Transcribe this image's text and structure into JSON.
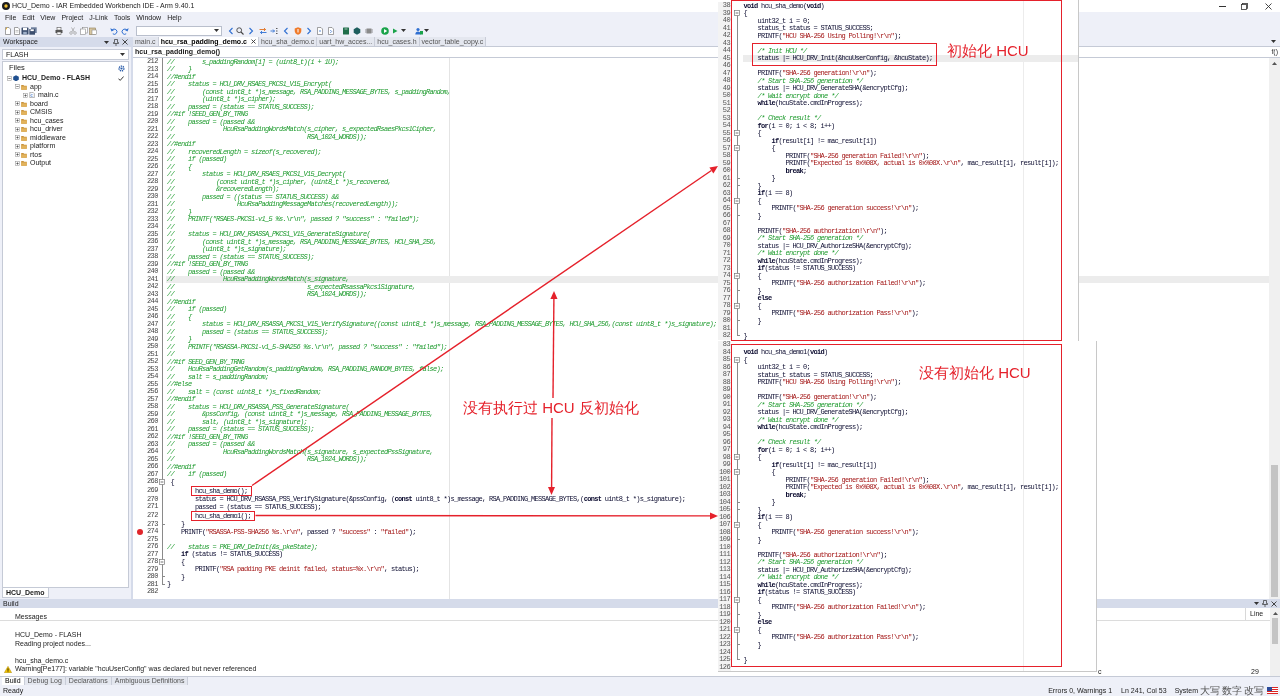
{
  "window": {
    "title": "HCU_Demo - IAR Embedded Workbench IDE - Arm 9.40.1"
  },
  "menu": [
    "File",
    "Edit",
    "View",
    "Project",
    "J-Link",
    "Tools",
    "Window",
    "Help"
  ],
  "workspace": {
    "title": "Workspace",
    "configuration": "FLASH",
    "files_header": "Files",
    "project": {
      "name": "HCU_Demo - FLASH",
      "kind": "project",
      "active": true,
      "expanded": true,
      "children": [
        {
          "name": "app",
          "kind": "folder",
          "expanded": true,
          "children": [
            {
              "name": "main.c",
              "kind": "file",
              "expanded": false
            }
          ]
        },
        {
          "name": "board",
          "kind": "folder",
          "expanded": false
        },
        {
          "name": "CMSIS",
          "kind": "folder",
          "expanded": false
        },
        {
          "name": "hcu_cases",
          "kind": "folder",
          "expanded": false
        },
        {
          "name": "hcu_driver",
          "kind": "folder",
          "expanded": false
        },
        {
          "name": "middleware",
          "kind": "folder",
          "expanded": false
        },
        {
          "name": "platform",
          "kind": "folder",
          "expanded": false
        },
        {
          "name": "rtos",
          "kind": "folder",
          "expanded": false
        },
        {
          "name": "Output",
          "kind": "folder",
          "expanded": false
        }
      ]
    },
    "tabs": [
      {
        "label": "HCU_Demo",
        "selected": true
      }
    ]
  },
  "editor": {
    "tabs": [
      {
        "label": "main.c",
        "selected": false
      },
      {
        "label": "hcu_rsa_padding_demo.c",
        "selected": true
      },
      {
        "label": "hcu_sha_demo.c",
        "selected": false
      },
      {
        "label": "uart_hw_acces...",
        "selected": false
      },
      {
        "label": "hcu_cases.h",
        "selected": false
      },
      {
        "label": "vector_table_copy.c",
        "selected": false
      }
    ],
    "function": "hcu_rsa_padding_demo()",
    "function_list_button": "f()",
    "lines": [
      {
        "number": "212",
        "tokens": [
          {
            "kind": "comment",
            "text": "//        s_paddingRandom[i] = (uint8_t)(i + 1U);"
          }
        ]
      },
      {
        "number": "213",
        "tokens": [
          {
            "kind": "comment",
            "text": "//    }"
          }
        ]
      },
      {
        "number": "214",
        "tokens": [
          {
            "kind": "comment",
            "text": "//#endif"
          }
        ]
      },
      {
        "number": "215",
        "tokens": [
          {
            "kind": "comment",
            "text": "//    status = HCU_DRV_RSAES_PKCS1_V15_Encrypt("
          }
        ]
      },
      {
        "number": "216",
        "tokens": [
          {
            "kind": "comment",
            "text": "//        (const uint8_t *)s_message, RSA_PADDING_MESSAGE_BYTES, s_paddingRandom,"
          }
        ]
      },
      {
        "number": "217",
        "tokens": [
          {
            "kind": "comment",
            "text": "//        (uint8_t *)s_cipher);"
          }
        ]
      },
      {
        "number": "218",
        "tokens": [
          {
            "kind": "comment",
            "text": "//    passed = (status == STATUS_SUCCESS);"
          }
        ]
      },
      {
        "number": "219",
        "tokens": [
          {
            "kind": "comment",
            "text": "//#if !SEED_GEN_BY_TRNG"
          }
        ]
      },
      {
        "number": "220",
        "tokens": [
          {
            "kind": "comment",
            "text": "//    passed = (passed &&"
          }
        ]
      },
      {
        "number": "221",
        "tokens": [
          {
            "kind": "comment",
            "text": "//              HcuRsaPaddingWordsMatch(s_cipher, s_expectedRsaesPkcs1Cipher,"
          }
        ]
      },
      {
        "number": "222",
        "tokens": [
          {
            "kind": "comment",
            "text": "//                                      RSA_1024_WORDS));"
          }
        ]
      },
      {
        "number": "223",
        "tokens": [
          {
            "kind": "comment",
            "text": "//#endif"
          }
        ]
      },
      {
        "number": "224",
        "tokens": [
          {
            "kind": "comment",
            "text": "//    recoveredLength = sizeof(s_recovered);"
          }
        ]
      },
      {
        "number": "225",
        "tokens": [
          {
            "kind": "comment",
            "text": "//    if (passed)"
          }
        ]
      },
      {
        "number": "226",
        "tokens": [
          {
            "kind": "comment",
            "text": "//    {"
          }
        ]
      },
      {
        "number": "227",
        "tokens": [
          {
            "kind": "comment",
            "text": "//        status = HCU_DRV_RSAES_PKCS1_V15_Decrypt("
          }
        ]
      },
      {
        "number": "228",
        "tokens": [
          {
            "kind": "comment",
            "text": "//            (const uint8_t *)s_cipher, (uint8_t *)s_recovered,"
          }
        ]
      },
      {
        "number": "229",
        "tokens": [
          {
            "kind": "comment",
            "text": "//            &recoveredLength);"
          }
        ]
      },
      {
        "number": "230",
        "tokens": [
          {
            "kind": "comment",
            "text": "//        passed = ((status == STATUS_SUCCESS) &&"
          }
        ]
      },
      {
        "number": "231",
        "tokens": [
          {
            "kind": "comment",
            "text": "//                  HcuRsaPaddingMessageMatches(recoveredLength));"
          }
        ]
      },
      {
        "number": "232",
        "tokens": [
          {
            "kind": "comment",
            "text": "//    }"
          }
        ]
      },
      {
        "number": "233",
        "tokens": [
          {
            "kind": "comment",
            "text": "//    PRINTF(\"RSAES-PKCS1-v1_5 %s.\\r\\n\", passed ? \"success\" : \"failed\");"
          }
        ]
      },
      {
        "number": "234",
        "tokens": [
          {
            "kind": "comment",
            "text": "//"
          }
        ]
      },
      {
        "number": "235",
        "tokens": [
          {
            "kind": "comment",
            "text": "//    status = HCU_DRV_RSASSA_PKCS1_V15_GenerateSignature("
          }
        ]
      },
      {
        "number": "236",
        "tokens": [
          {
            "kind": "comment",
            "text": "//        (const uint8_t *)s_message, RSA_PADDING_MESSAGE_BYTES, HCU_SHA_256,"
          }
        ]
      },
      {
        "number": "237",
        "tokens": [
          {
            "kind": "comment",
            "text": "//        (uint8_t *)s_signature);"
          }
        ]
      },
      {
        "number": "238",
        "tokens": [
          {
            "kind": "comment",
            "text": "//    passed = (status == STATUS_SUCCESS);"
          }
        ]
      },
      {
        "number": "239",
        "tokens": [
          {
            "kind": "comment",
            "text": "//#if !SEED_GEN_BY_TRNG"
          }
        ]
      },
      {
        "number": "240",
        "tokens": [
          {
            "kind": "comment",
            "text": "//    passed = (passed &&"
          }
        ]
      },
      {
        "number": "241",
        "current": true,
        "tokens": [
          {
            "kind": "comment",
            "text": "//              HcuRsaPaddingWordsMatch(s_signature,"
          }
        ]
      },
      {
        "number": "242",
        "tokens": [
          {
            "kind": "comment",
            "text": "//                                      s_expectedRsassaPkcs1Signature,"
          }
        ]
      },
      {
        "number": "243",
        "tokens": [
          {
            "kind": "comment",
            "text": "//                                      RSA_1024_WORDS));"
          }
        ]
      },
      {
        "number": "244",
        "tokens": [
          {
            "kind": "comment",
            "text": "//#endif"
          }
        ]
      },
      {
        "number": "245",
        "tokens": [
          {
            "kind": "comment",
            "text": "//    if (passed)"
          }
        ]
      },
      {
        "number": "246",
        "tokens": [
          {
            "kind": "comment",
            "text": "//    {"
          }
        ]
      },
      {
        "number": "247",
        "tokens": [
          {
            "kind": "comment",
            "text": "//        status = HCU_DRV_RSASSA_PKCS1_V15_VerifySignature((const uint8_t *)s_message, RSA_PADDING_MESSAGE_BYTES, HCU_SHA_256,(const uint8_t *)s_signature);"
          }
        ]
      },
      {
        "number": "248",
        "tokens": [
          {
            "kind": "comment",
            "text": "//        passed = (status == STATUS_SUCCESS);"
          }
        ]
      },
      {
        "number": "249",
        "tokens": [
          {
            "kind": "comment",
            "text": "//    }"
          }
        ]
      },
      {
        "number": "250",
        "tokens": [
          {
            "kind": "comment",
            "text": "//    PRINTF(\"RSASSA-PKCS1-v1_5-SHA256 %s.\\r\\n\", passed ? \"success\" : \"failed\");"
          }
        ]
      },
      {
        "number": "251",
        "tokens": [
          {
            "kind": "comment",
            "text": "//"
          }
        ]
      },
      {
        "number": "252",
        "tokens": [
          {
            "kind": "comment",
            "text": "//#if SEED_GEN_BY_TRNG"
          }
        ]
      },
      {
        "number": "253",
        "tokens": [
          {
            "kind": "comment",
            "text": "//    HcuRsaPaddingGetRandom(s_paddingRandom, RSA_PADDING_RANDOM_BYTES, false);"
          }
        ]
      },
      {
        "number": "254",
        "tokens": [
          {
            "kind": "comment",
            "text": "//    salt = s_paddingRandom;"
          }
        ]
      },
      {
        "number": "255",
        "tokens": [
          {
            "kind": "comment",
            "text": "//#else"
          }
        ]
      },
      {
        "number": "256",
        "tokens": [
          {
            "kind": "comment",
            "text": "//    salt = (const uint8_t *)s_fixedRandom;"
          }
        ]
      },
      {
        "number": "257",
        "tokens": [
          {
            "kind": "comment",
            "text": "//#endif"
          }
        ]
      },
      {
        "number": "258",
        "tokens": [
          {
            "kind": "comment",
            "text": "//    status = HCU_DRV_RSASSA_PSS_GenerateSignature("
          }
        ]
      },
      {
        "number": "259",
        "tokens": [
          {
            "kind": "comment",
            "text": "//        &pssConfig, (const uint8_t *)s_message, RSA_PADDING_MESSAGE_BYTES,"
          }
        ]
      },
      {
        "number": "260",
        "tokens": [
          {
            "kind": "comment",
            "text": "//        salt, (uint8_t *)s_signature);"
          }
        ]
      },
      {
        "number": "261",
        "tokens": [
          {
            "kind": "comment",
            "text": "//    passed = (status == STATUS_SUCCESS);"
          }
        ]
      },
      {
        "number": "262",
        "tokens": [
          {
            "kind": "comment",
            "text": "//#if !SEED_GEN_BY_TRNG"
          }
        ]
      },
      {
        "number": "263",
        "tokens": [
          {
            "kind": "comment",
            "text": "//    passed = (passed &&"
          }
        ]
      },
      {
        "number": "264",
        "tokens": [
          {
            "kind": "comment",
            "text": "//              HcuRsaPaddingWordsMatch(s_signature, s_expectedPssSignature,"
          }
        ]
      },
      {
        "number": "265",
        "tokens": [
          {
            "kind": "comment",
            "text": "//                                      RSA_1024_WORDS));"
          }
        ]
      },
      {
        "number": "266",
        "tokens": [
          {
            "kind": "comment",
            "text": "//#endif"
          }
        ]
      },
      {
        "number": "267",
        "tokens": [
          {
            "kind": "comment",
            "text": "//    if (passed)"
          }
        ]
      },
      {
        "number": "268",
        "fold_start": true,
        "tokens": [
          {
            "kind": "plain",
            "text": " {"
          }
        ]
      },
      {
        "number": "269",
        "boxed": true,
        "tokens": [
          {
            "kind": "plain",
            "text": "        hcu_sha_demo();"
          }
        ]
      },
      {
        "number": "270",
        "tokens": [
          {
            "kind": "plain",
            "text": "        status = HCU_DRV_RSASSA_PSS_VerifySignature(&pssConfig, ("
          },
          {
            "kind": "keyword",
            "text": "const"
          },
          {
            "kind": "plain",
            "text": " uint8_t *)s_message, RSA_PADDING_MESSAGE_BYTES,("
          },
          {
            "kind": "keyword",
            "text": "const"
          },
          {
            "kind": "plain",
            "text": " uint8_t *)s_signature);"
          }
        ]
      },
      {
        "number": "271",
        "tokens": [
          {
            "kind": "plain",
            "text": "        passed = (status == STATUS_SUCCESS);"
          }
        ]
      },
      {
        "number": "272",
        "boxed": true,
        "tokens": [
          {
            "kind": "plain",
            "text": "        hcu_sha_demo1();"
          }
        ]
      },
      {
        "number": "273",
        "fold_end": true,
        "tokens": [
          {
            "kind": "plain",
            "text": "    }"
          }
        ]
      },
      {
        "number": "274",
        "breakpoint": true,
        "tokens": [
          {
            "kind": "plain",
            "text": "    PRINTF("
          },
          {
            "kind": "string",
            "text": "\"RSASSA-PSS-SHA256 %s.\\r\\n\""
          },
          {
            "kind": "plain",
            "text": ", passed ? "
          },
          {
            "kind": "string",
            "text": "\"success\""
          },
          {
            "kind": "plain",
            "text": " : "
          },
          {
            "kind": "string",
            "text": "\"failed\""
          },
          {
            "kind": "plain",
            "text": ");"
          }
        ]
      },
      {
        "number": "275"
      },
      {
        "number": "276",
        "tokens": [
          {
            "kind": "comment",
            "text": "//    status = PKE_DRV_DeInit(&s_pkeState);"
          }
        ]
      },
      {
        "number": "277",
        "tokens": [
          {
            "kind": "keyword",
            "text": "    if"
          },
          {
            "kind": "plain",
            "text": " (status != STATUS_SUCCESS)"
          }
        ]
      },
      {
        "number": "278",
        "fold_start": true,
        "tokens": [
          {
            "kind": "plain",
            "text": "    {"
          }
        ]
      },
      {
        "number": "279",
        "tokens": [
          {
            "kind": "plain",
            "text": "        PRINTF("
          },
          {
            "kind": "string",
            "text": "\"RSA padding PKE deinit failed, status=%x.\\r\\n\""
          },
          {
            "kind": "plain",
            "text": ", status);"
          }
        ]
      },
      {
        "number": "280",
        "fold_end": true,
        "tokens": [
          {
            "kind": "plain",
            "text": "    }"
          }
        ]
      },
      {
        "number": "281",
        "fold_end": true,
        "tokens": [
          {
            "kind": "plain",
            "text": "}"
          }
        ]
      },
      {
        "number": "282"
      }
    ],
    "note": "没有执行过 HCU 反初始化"
  },
  "code_snippets": [
    {
      "lines": [
        {
          "number": "38",
          "tokens": [
            {
              "kind": "keyword",
              "text": "void"
            },
            {
              "kind": "plain",
              "text": " hcu_sha_demo("
            },
            {
              "kind": "keyword",
              "text": "void"
            },
            {
              "kind": "plain",
              "text": ")"
            }
          ]
        },
        {
          "number": "39",
          "fold_start": true,
          "tokens": [
            {
              "kind": "plain",
              "text": "{"
            }
          ]
        },
        {
          "number": "40",
          "tokens": [
            {
              "kind": "plain",
              "text": "    uint32_t i = 0;"
            }
          ]
        },
        {
          "number": "41",
          "tokens": [
            {
              "kind": "plain",
              "text": "    status_t status = STATUS_SUCCESS;"
            }
          ]
        },
        {
          "number": "42",
          "tokens": [
            {
              "kind": "plain",
              "text": "    PRINTF("
            },
            {
              "kind": "string",
              "text": "\"HCU SHA-256 Using Polling!\\r\\n\""
            },
            {
              "kind": "plain",
              "text": ");"
            }
          ]
        },
        {
          "number": "43"
        },
        {
          "number": "44",
          "tokens": [
            {
              "kind": "comment",
              "text": "    /* Init HCU */"
            }
          ]
        },
        {
          "number": "45",
          "current": true,
          "tokens": [
            {
              "kind": "plain",
              "text": "    status |= HCU_DRV_Init(&hcuUserConfig, &hcuState);"
            }
          ]
        },
        {
          "number": "46"
        },
        {
          "number": "47",
          "tokens": [
            {
              "kind": "plain",
              "text": "    PRINTF("
            },
            {
              "kind": "string",
              "text": "\"SHA-256 generation!\\r\\n\""
            },
            {
              "kind": "plain",
              "text": ");"
            }
          ]
        },
        {
          "number": "48",
          "tokens": [
            {
              "kind": "comment",
              "text": "    /* Start SHA-256 generation */"
            }
          ]
        },
        {
          "number": "49",
          "tokens": [
            {
              "kind": "plain",
              "text": "    status |= HCU_DRV_GenerateSHA(&encryptCfg);"
            }
          ]
        },
        {
          "number": "50",
          "tokens": [
            {
              "kind": "comment",
              "text": "    /* Wait encrypt done */"
            }
          ]
        },
        {
          "number": "51",
          "tokens": [
            {
              "kind": "keyword",
              "text": "    while"
            },
            {
              "kind": "plain",
              "text": "(hcuState.cmdInProgress);"
            }
          ]
        },
        {
          "number": "52"
        },
        {
          "number": "53",
          "tokens": [
            {
              "kind": "comment",
              "text": "    /* Check result */"
            }
          ]
        },
        {
          "number": "54",
          "tokens": [
            {
              "kind": "keyword",
              "text": "    for"
            },
            {
              "kind": "plain",
              "text": "(i = 0; i < 8; i++)"
            }
          ]
        },
        {
          "number": "55",
          "fold_start": true,
          "tokens": [
            {
              "kind": "plain",
              "text": "    {"
            }
          ]
        },
        {
          "number": "56",
          "tokens": [
            {
              "kind": "keyword",
              "text": "        if"
            },
            {
              "kind": "plain",
              "text": "(result[i] != mac_result[i])"
            }
          ]
        },
        {
          "number": "57",
          "fold_start": true,
          "tokens": [
            {
              "kind": "plain",
              "text": "        {"
            }
          ]
        },
        {
          "number": "58",
          "tokens": [
            {
              "kind": "plain",
              "text": "            PRINTF("
            },
            {
              "kind": "string",
              "text": "\"SHA-256 generation Failed!\\r\\n\""
            },
            {
              "kind": "plain",
              "text": ");"
            }
          ]
        },
        {
          "number": "59",
          "tokens": [
            {
              "kind": "plain",
              "text": "            PRINTF("
            },
            {
              "kind": "string",
              "text": "\"Expected is 0x%08X, actual is 0x%08X.\\r\\n\""
            },
            {
              "kind": "plain",
              "text": ", mac_result[i], result[i]);"
            }
          ]
        },
        {
          "number": "60",
          "tokens": [
            {
              "kind": "keyword",
              "text": "            break"
            },
            {
              "kind": "plain",
              "text": ";"
            }
          ]
        },
        {
          "number": "61",
          "fold_end": true,
          "tokens": [
            {
              "kind": "plain",
              "text": "        }"
            }
          ]
        },
        {
          "number": "62",
          "fold_end": true,
          "tokens": [
            {
              "kind": "plain",
              "text": "    }"
            }
          ]
        },
        {
          "number": "63",
          "tokens": [
            {
              "kind": "keyword",
              "text": "    if"
            },
            {
              "kind": "plain",
              "text": "(i == 8)"
            }
          ]
        },
        {
          "number": "64",
          "fold_start": true,
          "tokens": [
            {
              "kind": "plain",
              "text": "    {"
            }
          ]
        },
        {
          "number": "65",
          "tokens": [
            {
              "kind": "plain",
              "text": "        PRINTF("
            },
            {
              "kind": "string",
              "text": "\"SHA-256 generation success!\\r\\n\""
            },
            {
              "kind": "plain",
              "text": ");"
            }
          ]
        },
        {
          "number": "66",
          "fold_end": true,
          "tokens": [
            {
              "kind": "plain",
              "text": "    }"
            }
          ]
        },
        {
          "number": "67"
        },
        {
          "number": "68",
          "tokens": [
            {
              "kind": "plain",
              "text": "    PRINTF("
            },
            {
              "kind": "string",
              "text": "\"SHA-256 authorization!\\r\\n\""
            },
            {
              "kind": "plain",
              "text": ");"
            }
          ]
        },
        {
          "number": "69",
          "tokens": [
            {
              "kind": "comment",
              "text": "    /* Start SHA-256 generation */"
            }
          ]
        },
        {
          "number": "70",
          "tokens": [
            {
              "kind": "plain",
              "text": "    status |= HCU_DRV_AuthorizeSHA(&encryptCfg);"
            }
          ]
        },
        {
          "number": "71",
          "tokens": [
            {
              "kind": "comment",
              "text": "    /* Wait encrypt done */"
            }
          ]
        },
        {
          "number": "72",
          "tokens": [
            {
              "kind": "keyword",
              "text": "    while"
            },
            {
              "kind": "plain",
              "text": "(hcuState.cmdInProgress);"
            }
          ]
        },
        {
          "number": "73",
          "tokens": [
            {
              "kind": "keyword",
              "text": "    if"
            },
            {
              "kind": "plain",
              "text": "(status != STATUS_SUCCESS)"
            }
          ]
        },
        {
          "number": "74",
          "fold_start": true,
          "tokens": [
            {
              "kind": "plain",
              "text": "    {"
            }
          ]
        },
        {
          "number": "75",
          "tokens": [
            {
              "kind": "plain",
              "text": "        PRINTF("
            },
            {
              "kind": "string",
              "text": "\"SHA-256 authorization Failed!\\r\\n\""
            },
            {
              "kind": "plain",
              "text": ");"
            }
          ]
        },
        {
          "number": "76",
          "fold_end": true,
          "tokens": [
            {
              "kind": "plain",
              "text": "    }"
            }
          ]
        },
        {
          "number": "77",
          "tokens": [
            {
              "kind": "keyword",
              "text": "    else"
            }
          ]
        },
        {
          "number": "78",
          "fold_start": true,
          "tokens": [
            {
              "kind": "plain",
              "text": "    {"
            }
          ]
        },
        {
          "number": "79",
          "tokens": [
            {
              "kind": "plain",
              "text": "        PRINTF("
            },
            {
              "kind": "string",
              "text": "\"SHA-256 authorization Pass!\\r\\n\""
            },
            {
              "kind": "plain",
              "text": ");"
            }
          ]
        },
        {
          "number": "80",
          "fold_end": true,
          "tokens": [
            {
              "kind": "plain",
              "text": "    }"
            }
          ]
        },
        {
          "number": "81"
        },
        {
          "number": "82",
          "fold_end": true,
          "tokens": [
            {
              "kind": "plain",
              "text": "}"
            }
          ]
        }
      ],
      "note": "初始化 HCU"
    },
    {
      "lines": [
        {
          "number": "83"
        },
        {
          "number": "84",
          "tokens": [
            {
              "kind": "keyword",
              "text": "void"
            },
            {
              "kind": "plain",
              "text": " hcu_sha_demo1("
            },
            {
              "kind": "keyword",
              "text": "void"
            },
            {
              "kind": "plain",
              "text": ")"
            }
          ]
        },
        {
          "number": "85",
          "fold_start": true,
          "tokens": [
            {
              "kind": "plain",
              "text": "{"
            }
          ]
        },
        {
          "number": "86",
          "tokens": [
            {
              "kind": "plain",
              "text": "    uint32_t i = 0;"
            }
          ]
        },
        {
          "number": "87",
          "tokens": [
            {
              "kind": "plain",
              "text": "    status_t status = STATUS_SUCCESS;"
            }
          ]
        },
        {
          "number": "88",
          "tokens": [
            {
              "kind": "plain",
              "text": "    PRINTF("
            },
            {
              "kind": "string",
              "text": "\"HCU SHA-256 Using Polling!\\r\\n\""
            },
            {
              "kind": "plain",
              "text": ");"
            }
          ]
        },
        {
          "number": "89"
        },
        {
          "number": "90",
          "tokens": [
            {
              "kind": "plain",
              "text": "    PRINTF("
            },
            {
              "kind": "string",
              "text": "\"SHA-256 generation!\\r\\n\""
            },
            {
              "kind": "plain",
              "text": ");"
            }
          ]
        },
        {
          "number": "91",
          "tokens": [
            {
              "kind": "comment",
              "text": "    /* Start SHA-256 generation */"
            }
          ]
        },
        {
          "number": "92",
          "tokens": [
            {
              "kind": "plain",
              "text": "    status |= HCU_DRV_GenerateSHA(&encryptCfg);"
            }
          ]
        },
        {
          "number": "93",
          "tokens": [
            {
              "kind": "comment",
              "text": "    /* Wait encrypt done */"
            }
          ]
        },
        {
          "number": "94",
          "tokens": [
            {
              "kind": "keyword",
              "text": "    while"
            },
            {
              "kind": "plain",
              "text": "(hcuState.cmdInProgress);"
            }
          ]
        },
        {
          "number": "95"
        },
        {
          "number": "96",
          "tokens": [
            {
              "kind": "comment",
              "text": "    /* Check result */"
            }
          ]
        },
        {
          "number": "97",
          "tokens": [
            {
              "kind": "keyword",
              "text": "    for"
            },
            {
              "kind": "plain",
              "text": "(i = 0; i < 8; i++)"
            }
          ]
        },
        {
          "number": "98",
          "fold_start": true,
          "tokens": [
            {
              "kind": "plain",
              "text": "    {"
            }
          ]
        },
        {
          "number": "99",
          "tokens": [
            {
              "kind": "keyword",
              "text": "        if"
            },
            {
              "kind": "plain",
              "text": "(result[i] != mac_result[i])"
            }
          ]
        },
        {
          "number": "100",
          "fold_start": true,
          "tokens": [
            {
              "kind": "plain",
              "text": "        {"
            }
          ]
        },
        {
          "number": "101",
          "tokens": [
            {
              "kind": "plain",
              "text": "            PRINTF("
            },
            {
              "kind": "string",
              "text": "\"SHA-256 generation Failed!\\r\\n\""
            },
            {
              "kind": "plain",
              "text": ");"
            }
          ]
        },
        {
          "number": "102",
          "tokens": [
            {
              "kind": "plain",
              "text": "            PRINTF("
            },
            {
              "kind": "string",
              "text": "\"Expected is 0x%08X, actual is 0x%08X.\\r\\n\""
            },
            {
              "kind": "plain",
              "text": ", mac_result[i], result[i]);"
            }
          ]
        },
        {
          "number": "103",
          "tokens": [
            {
              "kind": "keyword",
              "text": "            break"
            },
            {
              "kind": "plain",
              "text": ";"
            }
          ]
        },
        {
          "number": "104",
          "fold_end": true,
          "tokens": [
            {
              "kind": "plain",
              "text": "        }"
            }
          ]
        },
        {
          "number": "105",
          "fold_end": true,
          "tokens": [
            {
              "kind": "plain",
              "text": "    }"
            }
          ]
        },
        {
          "number": "106",
          "tokens": [
            {
              "kind": "keyword",
              "text": "    if"
            },
            {
              "kind": "plain",
              "text": "(i == 8)"
            }
          ]
        },
        {
          "number": "107",
          "fold_start": true,
          "tokens": [
            {
              "kind": "plain",
              "text": "    {"
            }
          ]
        },
        {
          "number": "108",
          "tokens": [
            {
              "kind": "plain",
              "text": "        PRINTF("
            },
            {
              "kind": "string",
              "text": "\"SHA-256 generation success!\\r\\n\""
            },
            {
              "kind": "plain",
              "text": ");"
            }
          ]
        },
        {
          "number": "109",
          "fold_end": true,
          "tokens": [
            {
              "kind": "plain",
              "text": "    }"
            }
          ]
        },
        {
          "number": "110"
        },
        {
          "number": "111",
          "tokens": [
            {
              "kind": "plain",
              "text": "    PRINTF("
            },
            {
              "kind": "string",
              "text": "\"SHA-256 authorization!\\r\\n\""
            },
            {
              "kind": "plain",
              "text": ");"
            }
          ]
        },
        {
          "number": "112",
          "tokens": [
            {
              "kind": "comment",
              "text": "    /* Start SHA-256 generation */"
            }
          ]
        },
        {
          "number": "113",
          "tokens": [
            {
              "kind": "plain",
              "text": "    status |= HCU_DRV_AuthorizeSHA(&encryptCfg);"
            }
          ]
        },
        {
          "number": "114",
          "tokens": [
            {
              "kind": "comment",
              "text": "    /* Wait encrypt done */"
            }
          ]
        },
        {
          "number": "115",
          "tokens": [
            {
              "kind": "keyword",
              "text": "    while"
            },
            {
              "kind": "plain",
              "text": "(hcuState.cmdInProgress);"
            }
          ]
        },
        {
          "number": "116",
          "tokens": [
            {
              "kind": "keyword",
              "text": "    if"
            },
            {
              "kind": "plain",
              "text": "(status != STATUS_SUCCESS)"
            }
          ]
        },
        {
          "number": "117",
          "fold_start": true,
          "tokens": [
            {
              "kind": "plain",
              "text": "    {"
            }
          ]
        },
        {
          "number": "118",
          "tokens": [
            {
              "kind": "plain",
              "text": "        PRINTF("
            },
            {
              "kind": "string",
              "text": "\"SHA-256 authorization Failed!\\r\\n\""
            },
            {
              "kind": "plain",
              "text": ");"
            }
          ]
        },
        {
          "number": "119",
          "fold_end": true,
          "tokens": [
            {
              "kind": "plain",
              "text": "    }"
            }
          ]
        },
        {
          "number": "120",
          "tokens": [
            {
              "kind": "keyword",
              "text": "    else"
            }
          ]
        },
        {
          "number": "121",
          "fold_start": true,
          "tokens": [
            {
              "kind": "plain",
              "text": "    {"
            }
          ]
        },
        {
          "number": "122",
          "tokens": [
            {
              "kind": "plain",
              "text": "        PRINTF("
            },
            {
              "kind": "string",
              "text": "\"SHA-256 authorization Pass!\\r\\n\""
            },
            {
              "kind": "plain",
              "text": ");"
            }
          ]
        },
        {
          "number": "123",
          "fold_end": true,
          "tokens": [
            {
              "kind": "plain",
              "text": "    }"
            }
          ]
        },
        {
          "number": "124"
        },
        {
          "number": "125",
          "fold_end": true,
          "tokens": [
            {
              "kind": "plain",
              "text": "}"
            }
          ]
        },
        {
          "number": "126"
        }
      ],
      "note": "没有初始化 HCU"
    }
  ],
  "build": {
    "title": "Build",
    "columns": [
      "Messages",
      "Line"
    ],
    "messages": [
      {
        "kind": "info",
        "text": "HCU_Demo - FLASH"
      },
      {
        "kind": "info",
        "text": "Reading project nodes..."
      },
      {
        "kind": "file",
        "text": "hcu_sha_demo.c"
      },
      {
        "kind": "warning",
        "text": "Warning[Pe177]: variable \"hcuUserConfig\" was declared but never referenced",
        "column_2": "c",
        "line": "29"
      }
    ],
    "tabs": [
      {
        "label": "Build",
        "selected": true
      },
      {
        "label": "Debug Log",
        "selected": false
      },
      {
        "label": "Declarations",
        "selected": false
      },
      {
        "label": "Ambiguous Definitions",
        "selected": false
      }
    ]
  },
  "status_bar": {
    "text": "Ready",
    "errors": "Errors 0, Warnings 1",
    "position": "Ln 241, Col 53",
    "input_method": "System",
    "indicators": [
      "大写",
      "数字",
      "改写"
    ]
  }
}
